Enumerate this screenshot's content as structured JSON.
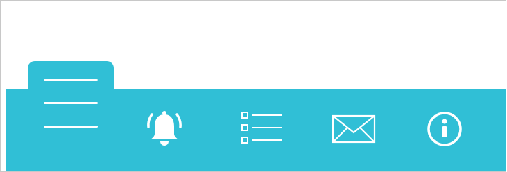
{
  "colors": {
    "accent": "#30bfd6",
    "icon": "#ffffff",
    "background": "#ffffff",
    "border": "#c8c8c8"
  },
  "nav": {
    "items": [
      {
        "id": "menu",
        "icon": "hamburger-menu-icon"
      },
      {
        "id": "notifications",
        "icon": "bell-icon"
      },
      {
        "id": "list",
        "icon": "checklist-icon"
      },
      {
        "id": "mail",
        "icon": "envelope-icon"
      },
      {
        "id": "info",
        "icon": "info-icon"
      }
    ],
    "active": "menu"
  }
}
